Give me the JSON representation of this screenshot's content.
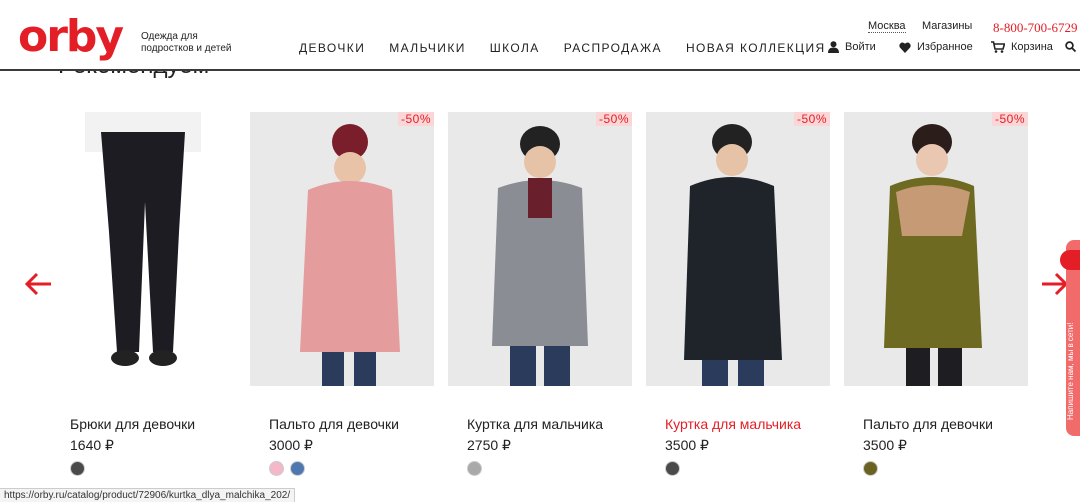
{
  "header": {
    "logo": "orby",
    "tagline": "Одежда для подростков и детей",
    "nav": [
      "ДЕВОЧКИ",
      "МАЛЬЧИКИ",
      "ШКОЛА",
      "РАСПРОДАЖА",
      "НОВАЯ КОЛЛЕКЦИЯ"
    ],
    "city": "Москва",
    "stores": "Магазины",
    "phone": "8-800-700-6729",
    "login": "Войти",
    "favorites": "Избранное",
    "cart": "Корзина"
  },
  "section": {
    "title": "Рекомендуем"
  },
  "products": [
    {
      "name": "Брюки для девочки",
      "price": "1640 ₽",
      "badge": "",
      "swatches": [
        "#4a4a4a"
      ],
      "photo_bg": "#f2f2f2",
      "garment": "#1c1c22"
    },
    {
      "name": "Пальто для девочки",
      "price": "3000 ₽",
      "badge": "-50%",
      "swatches": [
        "#f4b8c8",
        "#4f78b0"
      ],
      "photo_bg": "#e9e9ea",
      "garment": "#e49c9c"
    },
    {
      "name": "Куртка для мальчика",
      "price": "2750 ₽",
      "badge": "-50%",
      "swatches": [
        "#a9a9a9"
      ],
      "photo_bg": "#e9e9ea",
      "garment": "#8a8e94"
    },
    {
      "name": "Куртка для мальчика",
      "price": "3500 ₽",
      "badge": "-50%",
      "swatches": [
        "#4a4a4a"
      ],
      "photo_bg": "#e9e9ea",
      "garment": "#1f242b"
    },
    {
      "name": "Пальто для девочки",
      "price": "3500 ₽",
      "badge": "-50%",
      "swatches": [
        "#6b6121"
      ],
      "photo_bg": "#e9e9ea",
      "garment": "#6e6a22"
    }
  ],
  "status_url": "https://orby.ru/catalog/product/72906/kurtka_dlya_malchika_202/",
  "feedback": "Напишите нам, мы в сети!",
  "colors": {
    "accent": "#e41e26",
    "badge_bg": "#fbd6d6"
  }
}
